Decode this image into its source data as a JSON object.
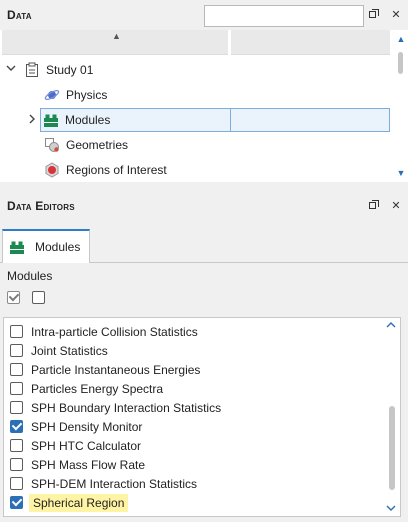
{
  "data_panel": {
    "title": "Data",
    "search": {
      "value": "",
      "placeholder": ""
    },
    "tree": {
      "root": {
        "label": "Study 01"
      },
      "children": [
        {
          "label": "Physics"
        },
        {
          "label": "Modules"
        },
        {
          "label": "Geometries"
        },
        {
          "label": "Regions of Interest"
        }
      ]
    }
  },
  "editors_panel": {
    "title": "Data Editors",
    "tab": {
      "label": "Modules"
    },
    "caption": "Modules",
    "list": [
      {
        "label": "Intra-particle Collision Statistics",
        "checked": false
      },
      {
        "label": "Joint Statistics",
        "checked": false
      },
      {
        "label": "Particle Instantaneous Energies",
        "checked": false
      },
      {
        "label": "Particles Energy Spectra",
        "checked": false
      },
      {
        "label": "SPH Boundary Interaction Statistics",
        "checked": false
      },
      {
        "label": "SPH Density Monitor",
        "checked": true
      },
      {
        "label": "SPH HTC Calculator",
        "checked": false
      },
      {
        "label": "SPH Mass Flow Rate",
        "checked": false
      },
      {
        "label": "SPH-DEM Interaction Statistics",
        "checked": false
      },
      {
        "label": "Spherical Region",
        "checked": true,
        "highlighted": true
      }
    ]
  },
  "colors": {
    "accent": "#2b6fb6",
    "selection_border": "#7eaddc",
    "highlight": "#fff4a3",
    "module_icon": "#1a8a50"
  },
  "icons": [
    "restore-icon",
    "close-icon",
    "study-icon",
    "physics-icon",
    "modules-icon",
    "geometries-icon",
    "regions-icon"
  ]
}
